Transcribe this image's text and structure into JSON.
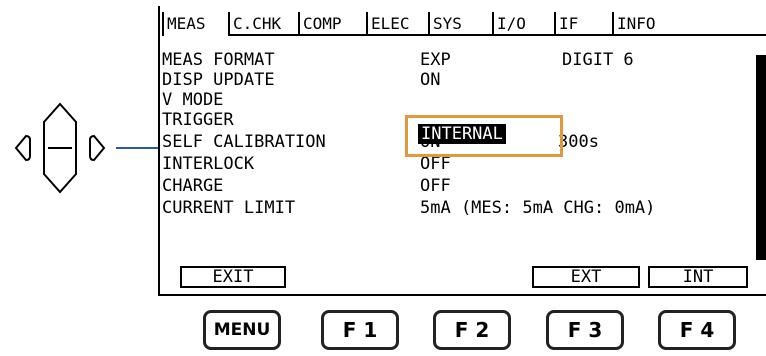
{
  "tabs": [
    "MEAS",
    "C.CHK",
    "COMP",
    "ELEC",
    "SYS",
    "I/O",
    "IF",
    "INFO"
  ],
  "rows": [
    {
      "label": "MEAS FORMAT",
      "value": "EXP",
      "extra": "DIGIT 6"
    },
    {
      "label": "DISP UPDATE",
      "value": "ON",
      "extra": ""
    },
    {
      "label": "V MODE",
      "value": "",
      "extra": ""
    },
    {
      "label": "TRIGGER",
      "value": "",
      "extra": ""
    },
    {
      "label": "SELF CALIBRATION",
      "value": "ON",
      "extra": "300s"
    },
    {
      "label": "INTERLOCK",
      "value": "OFF",
      "extra": ""
    },
    {
      "label": "CHARGE",
      "value": "OFF",
      "extra": ""
    },
    {
      "label": "CURRENT LIMIT",
      "value": "5mA (MES: 5mA CHG: 0mA)",
      "extra": ""
    }
  ],
  "trigger_value": "INTERNAL",
  "softkeys": {
    "f1": "EXIT",
    "f3": "EXT",
    "f4": "INT"
  },
  "buttons": {
    "menu": "MENU",
    "f1": "F 1",
    "f2": "F 2",
    "f3": "F 3",
    "f4": "F 4"
  },
  "colors": {
    "highlight_box": "#e0993c",
    "callout_line": "#2c5aa0"
  },
  "icons": {
    "cursor_keys": "up-down-left-right-cursor-key-icon"
  }
}
